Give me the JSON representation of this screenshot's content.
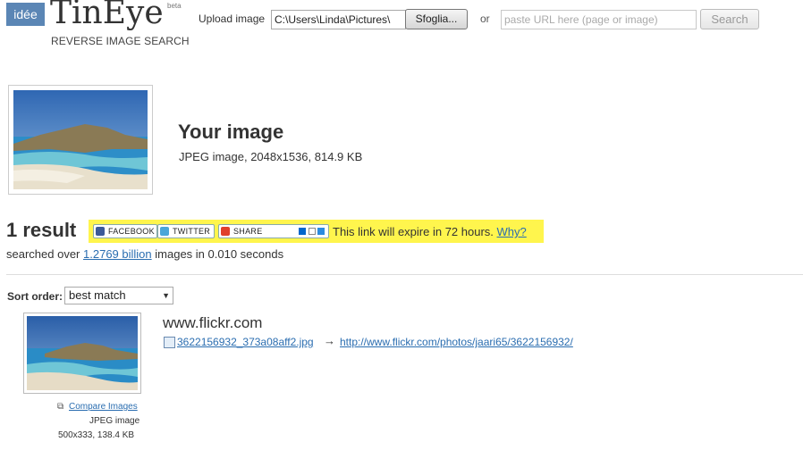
{
  "header": {
    "badge": "idée",
    "logo": "TinEye",
    "beta": "beta",
    "tagline": "REVERSE IMAGE SEARCH",
    "upload_label": "Upload image",
    "file_value": "C:\\Users\\Linda\\Pictures\\",
    "browse_label": "Sfoglia...",
    "or_label": "or",
    "url_placeholder": "paste URL here (page or image)",
    "search_label": "Search"
  },
  "query": {
    "title": "Your image",
    "meta": "JPEG image, 2048x1536, 814.9 KB"
  },
  "results": {
    "count": "1 result",
    "share_buttons": [
      "FACEBOOK",
      "TWITTER",
      "SHARE"
    ],
    "expire_text": "This link will expire in 72 hours.",
    "why": "Why?",
    "searched_prefix": "searched over",
    "searched_count": "1.2769 billion",
    "searched_suffix": "images in 0.010 seconds"
  },
  "sort": {
    "label": "Sort order:",
    "selected": "best match"
  },
  "matches": [
    {
      "domain": "www.flickr.com",
      "file": "3622156932_373a08aff2.jpg",
      "arrow": "→",
      "url": "http://www.flickr.com/photos/jaari65/3622156932/",
      "compare": "Compare Images",
      "type": "JPEG image",
      "size": "500x333, 138.4 KB"
    }
  ]
}
